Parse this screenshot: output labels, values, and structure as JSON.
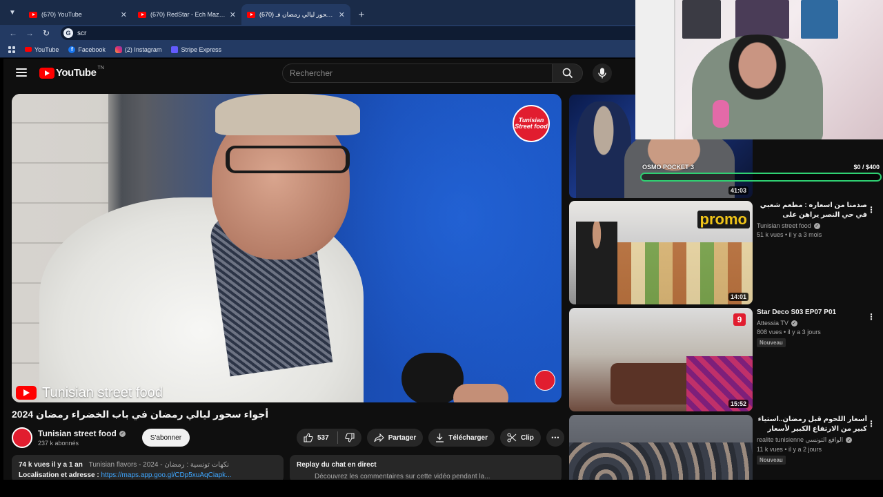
{
  "browser": {
    "tabs": [
      {
        "title": "(670) YouTube",
        "active": false
      },
      {
        "title": "(670) RedStar - Ech Mazel Feat",
        "active": false
      },
      {
        "title": "(670) أجواء سحور ليالي رمضان فـ",
        "active": true
      }
    ],
    "address": "scr",
    "bookmarks": [
      {
        "label": "YouTube",
        "icon": "youtube-icon"
      },
      {
        "label": "Facebook",
        "icon": "facebook-icon"
      },
      {
        "label": "(2) Instagram",
        "icon": "instagram-icon"
      },
      {
        "label": "Stripe Express",
        "icon": "stripe-icon"
      }
    ]
  },
  "youtube": {
    "logo_text": "YouTube",
    "logo_region": "TN",
    "search_placeholder": "Rechercher",
    "video": {
      "watermark": "Tunisian street food",
      "brand_logo": "Tunisian Street food",
      "title": "أجواء سحور ليالي رمضان في باب الخضراء رمضان 2024",
      "channel": "Tunisian street food",
      "subscribers": "237 k abonnés",
      "subscribe_label": "S'abonner",
      "likes": "537",
      "share_label": "Partager",
      "download_label": "Télécharger",
      "clip_label": "Clip",
      "views_date": "74 k vues  il y a 1 an",
      "tags": "Tunisian flavors - 2024 - نكهات تونسية : رمضان",
      "location_label": "Localisation et adresse :",
      "location_link": "https://maps.app.goo.gl/CDp5xuAqCiapk...",
      "chat_title": "Replay du chat en direct",
      "chat_sub": "Découvrez les commentaires sur cette vidéo pendant la..."
    },
    "related": [
      {
        "title": "",
        "channel": "",
        "stats": "",
        "duration": "41:03",
        "badge": ""
      },
      {
        "title": "صدمنا من اسعاره : مطعم شعبي في حي النصر يراهن على البروموات",
        "channel": "Tunisian street food",
        "stats": "51 k vues • il y a 3 mois",
        "duration": "14:01",
        "badge": "",
        "thumb_text": "promo"
      },
      {
        "title": "Star Deco S03 EP07 P01",
        "channel": "Attessia TV",
        "stats": "808 vues • il y a 3 jours",
        "duration": "15:52",
        "badge": "Nouveau",
        "thumb_text": "9"
      },
      {
        "title": "أسعار اللحوم قبل رمضان..استياء كبير من الارتفاع الكبير لأسعار التونسي ما يعرف اللحم...",
        "channel": "realite tunisienne الواقع التونسي",
        "stats": "11 k vues • il y a 2 jours",
        "duration": "",
        "badge": "Nouveau"
      }
    ]
  },
  "overlay": {
    "goal_label": "OSMO POCKET 3",
    "goal_amount": "$0  / $400",
    "goal_progress": 0.0
  },
  "colors": {
    "youtube_red": "#ff0000",
    "goal_green": "#2fd072",
    "browser_chrome": "#233a63"
  }
}
